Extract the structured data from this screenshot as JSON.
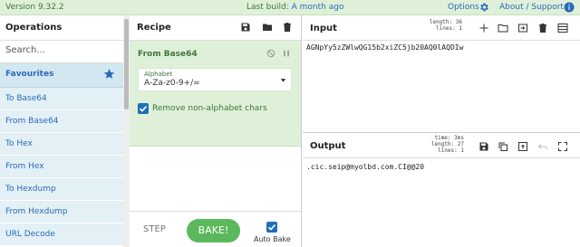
{
  "banner": {
    "version": "Version 9.32.2",
    "last_build_prefix": "Last build: ",
    "last_build_link": "A month ago",
    "options": "Options",
    "about": "About / Support"
  },
  "operations": {
    "title": "Operations",
    "search_placeholder": "Search...",
    "favourites_label": "Favourites",
    "items": [
      "To Base64",
      "From Base64",
      "To Hex",
      "From Hex",
      "To Hexdump",
      "From Hexdump",
      "URL Decode"
    ]
  },
  "recipe": {
    "title": "Recipe",
    "operation": {
      "title": "From Base64",
      "alphabet_label": "Alphabet",
      "alphabet_value": "A-Za-z0-9+/=",
      "remove_label": "Remove non-alphabet chars",
      "remove_checked": true
    },
    "step_label": "STEP",
    "bake_label": "BAKE!",
    "auto_bake_label": "Auto Bake",
    "auto_bake_checked": true
  },
  "input": {
    "title": "Input",
    "stats": {
      "length_label": "length:",
      "length": "36",
      "lines_label": "lines:",
      "lines": "1"
    },
    "text": "AGNpYy5zZWlwQG15b2xiZC5jb20AQ0lAQDIw"
  },
  "output": {
    "title": "Output",
    "stats": {
      "time_label": "time:",
      "time": "3ms",
      "length_label": "length:",
      "length": "27",
      "lines_label": "lines:",
      "lines": "1"
    },
    "text": ".cic.seip@myolbd.com.CI@@20"
  },
  "colors": {
    "accent": "#2a6ab8",
    "banner_bg": "#dff0d8",
    "bake_green": "#5cb85c",
    "checkbox_blue": "#1f6fb8"
  }
}
